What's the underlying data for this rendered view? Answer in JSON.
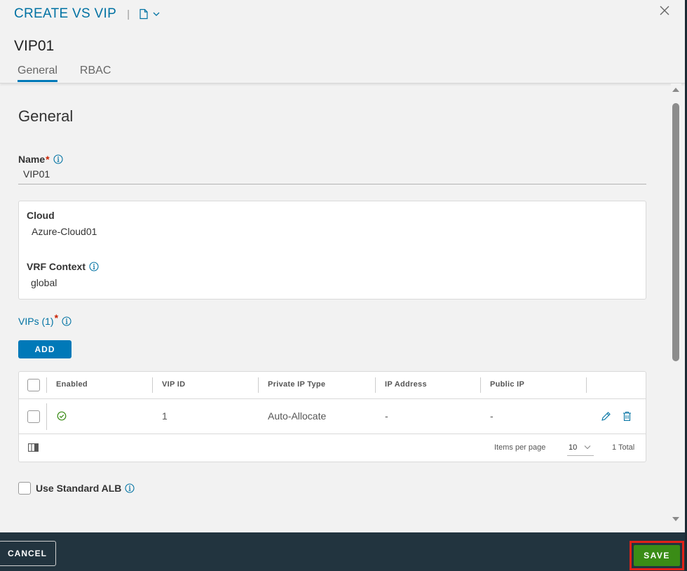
{
  "header": {
    "title": "CREATE VS VIP",
    "separator": "|",
    "object_name": "VIP01",
    "tabs": [
      {
        "label": "General",
        "active": true
      },
      {
        "label": "RBAC",
        "active": false
      }
    ]
  },
  "general": {
    "section_title": "General",
    "name_label": "Name",
    "name_required": "*",
    "name_value": "VIP01",
    "cloud_label": "Cloud",
    "cloud_value": "Azure-Cloud01",
    "vrf_label": "VRF Context",
    "vrf_value": "global",
    "vips_label": "VIPs (1)",
    "vips_required": "*",
    "add_button": "ADD"
  },
  "grid": {
    "columns": [
      "Enabled",
      "VIP ID",
      "Private IP Type",
      "IP Address",
      "Public IP"
    ],
    "rows": [
      {
        "enabled": true,
        "vip_id": "1",
        "private_ip_type": "Auto-Allocate",
        "ip_address": "-",
        "public_ip": "-"
      }
    ],
    "items_per_page_label": "Items per page",
    "items_per_page_value": "10",
    "total": "1 Total"
  },
  "options": {
    "use_standard_alb_label": "Use Standard ALB",
    "use_standard_alb_checked": false
  },
  "footer": {
    "cancel_label": "CANCEL",
    "save_label": "SAVE"
  },
  "colors": {
    "accent": "#0079b8",
    "save_green": "#3a8c16",
    "footer_bg": "#22343f",
    "highlight_red": "#e12118",
    "required_red": "#c92100",
    "enabled_green": "#3a8c16"
  }
}
